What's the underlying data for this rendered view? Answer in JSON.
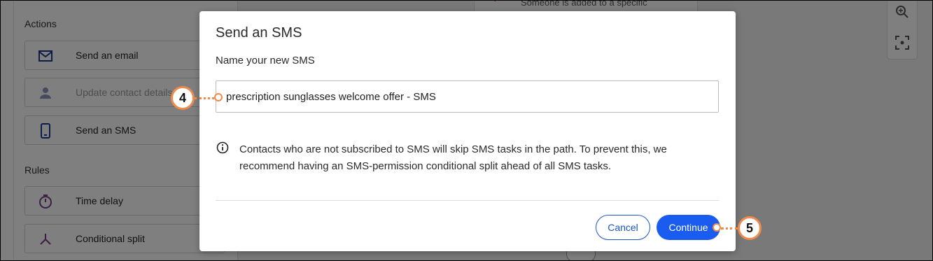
{
  "sidebar": {
    "actions_title": "Actions",
    "rules_title": "Rules",
    "actions": [
      {
        "label": "Send an email",
        "icon": "envelope-icon",
        "enabled": true
      },
      {
        "label": "Update contact details",
        "icon": "person-icon",
        "enabled": false
      },
      {
        "label": "Send an SMS",
        "icon": "mobile-phone-icon",
        "enabled": true
      }
    ],
    "rules": [
      {
        "label": "Time delay",
        "icon": "stopwatch-icon"
      },
      {
        "label": "Conditional split",
        "icon": "split-icon"
      }
    ]
  },
  "canvas": {
    "trigger_card_text": "Someone is added to a specific"
  },
  "modal": {
    "title": "Send an SMS",
    "name_label": "Name your new SMS",
    "name_value": "prescription sunglasses welcome offer - SMS",
    "info_text": "Contacts who are not subscribed to SMS will skip SMS tasks in the path. To prevent this, we recommend having an SMS-permission conditional split ahead of all SMS tasks.",
    "cancel_label": "Cancel",
    "continue_label": "Continue"
  },
  "callouts": {
    "step_4": "4",
    "step_5": "5"
  },
  "colors": {
    "primary": "#1b5cf0",
    "callout": "#f08a4b",
    "icon_blue": "#1a3a8a",
    "icon_purple": "#7a3a8a"
  }
}
